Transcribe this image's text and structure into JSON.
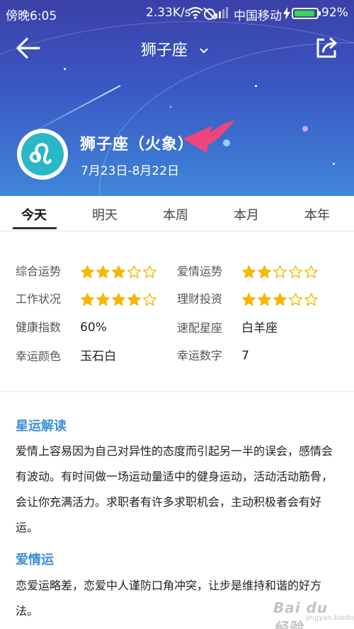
{
  "status_bar": {
    "time": "傍晚6:05",
    "speed": "2.33K/s",
    "carrier": "中国移动",
    "battery_pct": "92%",
    "battery_level": 0.92
  },
  "nav": {
    "title": "狮子座",
    "back_icon": "arrow-left-icon",
    "share_icon": "share-icon",
    "dropdown_icon": "chevron-down-icon"
  },
  "sign": {
    "icon": "leo-icon",
    "name": "狮子座（火象）",
    "date_range": "7月23日-8月22日"
  },
  "tabs": [
    {
      "label": "今天",
      "active": true
    },
    {
      "label": "明天",
      "active": false
    },
    {
      "label": "本周",
      "active": false
    },
    {
      "label": "本月",
      "active": false
    },
    {
      "label": "本年",
      "active": false
    }
  ],
  "fortune": {
    "overall": {
      "label": "综合运势",
      "stars": 3,
      "max": 5
    },
    "love": {
      "label": "爱情运势",
      "stars": 2,
      "max": 5
    },
    "work": {
      "label": "工作状况",
      "stars": 4,
      "max": 5
    },
    "finance": {
      "label": "理财投资",
      "stars": 3,
      "max": 5
    },
    "health": {
      "label": "健康指数",
      "value": "60%"
    },
    "match": {
      "label": "速配星座",
      "value": "白羊座"
    },
    "lucky_color": {
      "label": "幸运颜色",
      "value": "玉石白"
    },
    "lucky_number": {
      "label": "幸运数字",
      "value": "7"
    }
  },
  "article": {
    "reading_title": "星运解读",
    "reading_text": "爱情上容易因为自己对异性的态度而引起另一半的误会，感情会有波动。有时间做一场运动量适中的健身运动，活动活动筋骨，会让你充满活力。求职者有许多求职机会，主动积极者会有好运。",
    "love_title": "爱情运",
    "love_text": "恋爱运略差，恋爱中人谨防口角冲突，让步是维持和谐的好方法。"
  },
  "watermark": {
    "text": "Bai du 经验",
    "sub": "jingyan.baidu.com"
  },
  "colors": {
    "header_top": "#3b40a8",
    "header_bottom": "#3f86d9",
    "accent_blue": "#3d8fd6",
    "star_gold": "#f5b800",
    "leo_teal": "#2ab7c7",
    "annotation_pink": "#f0457a"
  }
}
